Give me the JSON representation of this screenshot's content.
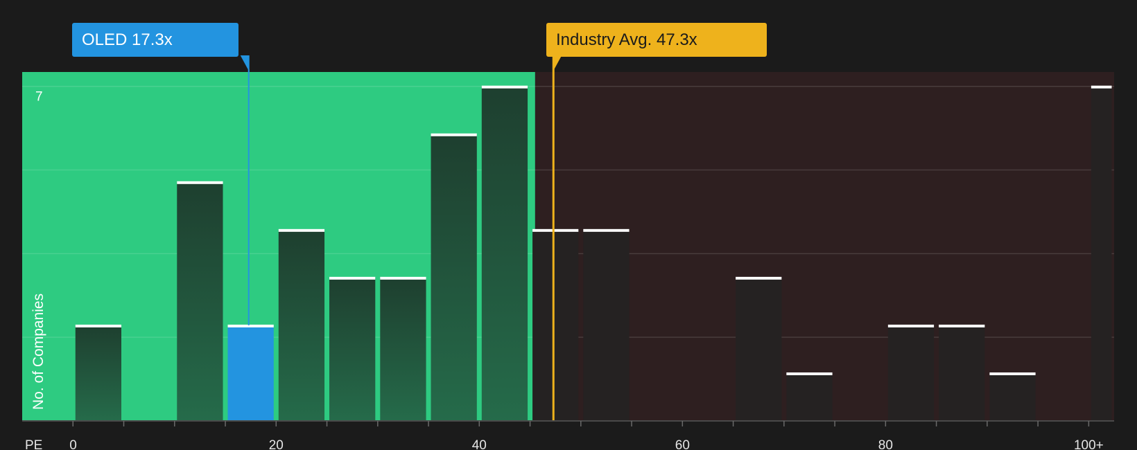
{
  "callouts": {
    "company": "OLED 17.3x",
    "industry": "Industry Avg. 47.3x"
  },
  "colors": {
    "background": "#1b1b1b",
    "undervalued_zone": "#2ecb81",
    "overvalued_zone": "#2e1f20",
    "bar_dark": "#1f4a35",
    "bar_neutral": "#252222",
    "company_bar": "#2394e0",
    "company_accent": "#2394e0",
    "industry_accent": "#eeb21c",
    "bar_cap": "#ffffff"
  },
  "chart_data": {
    "type": "bar",
    "xlabel": "PE",
    "ylabel": "No. of Companies",
    "xlim": [
      -5,
      102.5
    ],
    "ylim": [
      0,
      7.3
    ],
    "x_ticks": [
      {
        "value": 0,
        "label": "0"
      },
      {
        "value": 20,
        "label": "20"
      },
      {
        "value": 40,
        "label": "40"
      },
      {
        "value": 60,
        "label": "60"
      },
      {
        "value": 80,
        "label": "80"
      },
      {
        "value": 100,
        "label": "100+"
      }
    ],
    "y_ticks": [
      {
        "value": 7,
        "label": "7"
      }
    ],
    "bins": [
      {
        "start": 0,
        "end": 5,
        "count": 2
      },
      {
        "start": 5,
        "end": 10,
        "count": 0
      },
      {
        "start": 10,
        "end": 15,
        "count": 5
      },
      {
        "start": 15,
        "end": 20,
        "count": 2,
        "highlight": true
      },
      {
        "start": 20,
        "end": 25,
        "count": 4
      },
      {
        "start": 25,
        "end": 30,
        "count": 3
      },
      {
        "start": 30,
        "end": 35,
        "count": 3
      },
      {
        "start": 35,
        "end": 40,
        "count": 6
      },
      {
        "start": 40,
        "end": 45,
        "count": 7
      },
      {
        "start": 45,
        "end": 50,
        "count": 4
      },
      {
        "start": 50,
        "end": 55,
        "count": 4
      },
      {
        "start": 55,
        "end": 60,
        "count": 0
      },
      {
        "start": 60,
        "end": 65,
        "count": 0
      },
      {
        "start": 65,
        "end": 70,
        "count": 3
      },
      {
        "start": 70,
        "end": 75,
        "count": 1
      },
      {
        "start": 75,
        "end": 80,
        "count": 0
      },
      {
        "start": 80,
        "end": 85,
        "count": 2
      },
      {
        "start": 85,
        "end": 90,
        "count": 2
      },
      {
        "start": 90,
        "end": 95,
        "count": 1
      },
      {
        "start": 95,
        "end": 100,
        "count": 0
      },
      {
        "start": 100,
        "end": 102.5,
        "count": 7
      }
    ],
    "company": {
      "name": "OLED",
      "value": 17.3
    },
    "industry_avg": {
      "value": 47.3
    },
    "undervalued_zone_end": 45.5,
    "grid": true
  }
}
